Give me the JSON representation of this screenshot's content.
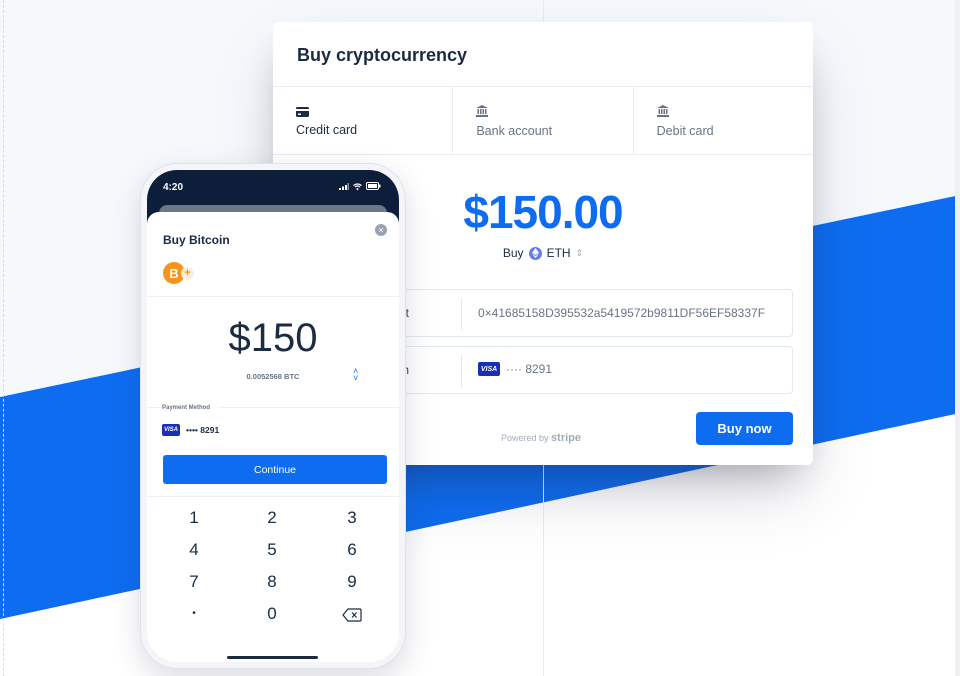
{
  "colors": {
    "accent": "#0d6cf0",
    "dark_navy": "#0c1e3a",
    "bitcoin": "#f7931a",
    "ethereum": "#627eea",
    "visa": "#1a2fb5"
  },
  "card": {
    "title": "Buy cryptocurrency",
    "tabs": [
      {
        "label": "Credit card",
        "icon": "credit-card-icon",
        "active": true
      },
      {
        "label": "Bank account",
        "icon": "bank-icon",
        "active": false
      },
      {
        "label": "Debit card",
        "icon": "bank-icon",
        "active": false
      }
    ],
    "amount": "$150.00",
    "buy_label": "Buy",
    "currency": "ETH",
    "fields": [
      {
        "label": "n wallet",
        "value": "0×41685158D395532a5419572b9811DF56EF58337F"
      },
      {
        "label": "Pay with",
        "card_brand": "VISA",
        "value": "···· 8291"
      }
    ],
    "powered_by": "Powered by",
    "powered_brand": "stripe",
    "buy_button": "Buy now"
  },
  "phone": {
    "time": "4:20",
    "title": "Buy Bitcoin",
    "coin_symbol": "B",
    "amount": "$150",
    "btc_amount": "0.0052568 BTC",
    "payment_method_label": "Payment Method",
    "card_brand": "VISA",
    "card_number": "•••• 8291",
    "continue_button": "Continue",
    "keys": [
      "1",
      "2",
      "3",
      "4",
      "5",
      "6",
      "7",
      "8",
      "9",
      "•",
      "0",
      "backspace"
    ]
  }
}
